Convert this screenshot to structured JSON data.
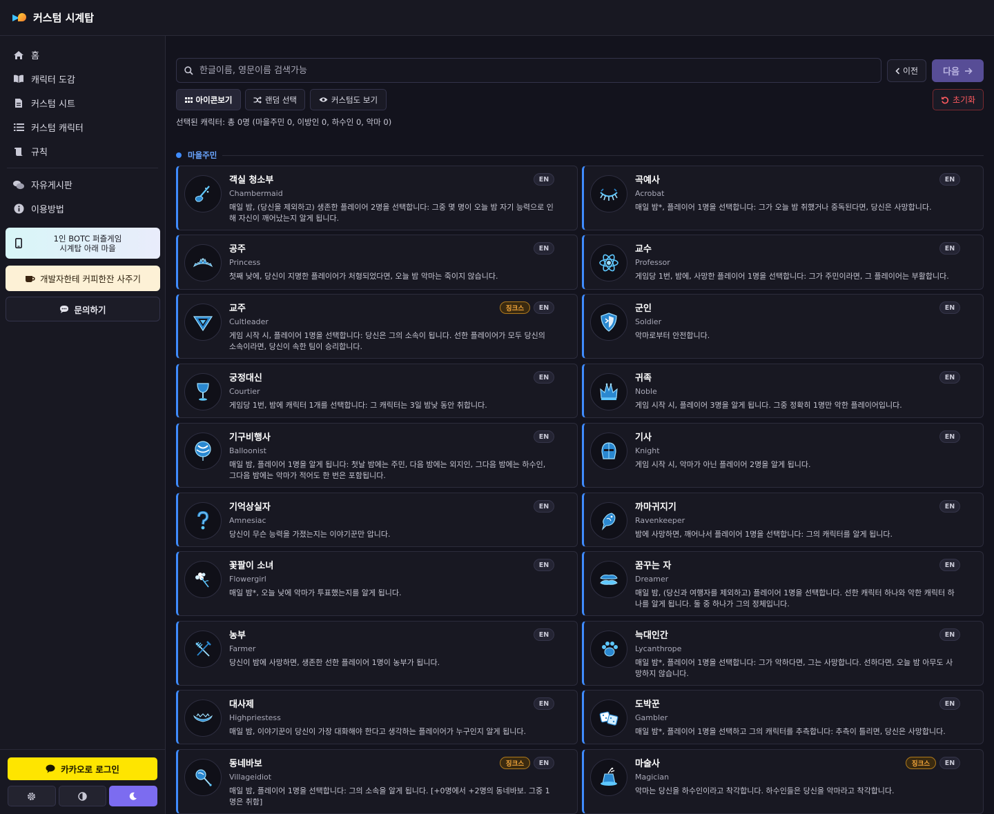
{
  "app": {
    "title": "커스텀 시계탑"
  },
  "sidebar": {
    "items": [
      {
        "label": "홈",
        "icon": "home-icon"
      },
      {
        "label": "캐릭터 도감",
        "icon": "book-icon"
      },
      {
        "label": "커스텀 시트",
        "icon": "document-icon"
      },
      {
        "label": "커스텀 캐릭터",
        "icon": "list-icon"
      },
      {
        "label": "규칙",
        "icon": "scroll-icon"
      },
      {
        "label": "자유게시판",
        "icon": "chat-bubbles-icon"
      },
      {
        "label": "이용방법",
        "icon": "info-icon"
      }
    ],
    "promo_botc": "1인 BOTC 퍼즐게임\n시계탑 아래 마을",
    "promo_botc_line1": "1인 BOTC 퍼즐게임",
    "promo_botc_line2": "시계탑 아래 마을",
    "promo_coffee": "개발자한테 커피한잔 사주기",
    "inquiry": "문의하기",
    "kakao_login": "카카오로 로그인"
  },
  "toolbar": {
    "search_placeholder": "한글이름, 영문이름 검색가능",
    "prev": "이전",
    "next": "다음",
    "icon_view": "아이콘보기",
    "random_select": "랜덤 선택",
    "custom_view": "커스텀도 보기",
    "reset": "초기화"
  },
  "selected_info": "선택된 캐릭터: 총 0명 (마을주민 0, 이방인 0, 하수인 0, 악마 0)",
  "section": {
    "title": "마을주민"
  },
  "badges": {
    "en": "EN",
    "jinx": "징크스"
  },
  "colors": {
    "accent": "#3f8cff",
    "primary": "#7c6cf0",
    "kakao": "#fee500",
    "danger": "#ff5a5f",
    "jinx": "#f2a53a"
  },
  "cards": [
    {
      "name": "객실 청소부",
      "eng": "Chambermaid",
      "desc": "매일 밤, (당신을 제외하고) 생존한 플레이어 2명을 선택합니다: 그중 몇 명이 오늘 밤 자기 능력으로 인해 자신이 깨어났는지 알게 됩니다.",
      "jinx": false,
      "icon": "mop-icon"
    },
    {
      "name": "곡예사",
      "eng": "Acrobat",
      "desc": "매일 밤*, 플레이어 1명을 선택합니다: 그가 오늘 밤 취했거나 중독된다면, 당신은 사망합니다.",
      "jinx": false,
      "icon": "eye-lashes-icon"
    },
    {
      "name": "공주",
      "eng": "Princess",
      "desc": "첫째 낮에, 당신이 지명한 플레이어가 처형되었다면, 오늘 밤 악마는 죽이지 않습니다.",
      "jinx": false,
      "icon": "tiara-icon"
    },
    {
      "name": "교수",
      "eng": "Professor",
      "desc": "게임당 1번, 밤에, 사망한 플레이어 1명을 선택합니다: 그가 주민이라면, 그 플레이어는 부활합니다.",
      "jinx": false,
      "icon": "atom-icon"
    },
    {
      "name": "교주",
      "eng": "Cultleader",
      "desc": "게임 시작 시, 플레이어 1명을 선택합니다: 당신은 그의 소속이 됩니다. 선한 플레이어가 모두 당신의 소속이라면, 당신이 속한 팀이 승리합니다.",
      "jinx": true,
      "icon": "triangle-icon"
    },
    {
      "name": "군인",
      "eng": "Soldier",
      "desc": "악마로부터 안전합니다.",
      "jinx": false,
      "icon": "shield-icon"
    },
    {
      "name": "궁정대신",
      "eng": "Courtier",
      "desc": "게임당 1번, 밤에 캐릭터 1개를 선택합니다: 그 캐릭터는 3일 밤낮 동안 취합니다.",
      "jinx": false,
      "icon": "goblet-icon"
    },
    {
      "name": "귀족",
      "eng": "Noble",
      "desc": "게임 시작 시, 플레이어 3명을 알게 됩니다. 그중 정확히 1명만 악한 플레이어입니다.",
      "jinx": false,
      "icon": "crown-icon"
    },
    {
      "name": "기구비행사",
      "eng": "Balloonist",
      "desc": "매일 밤, 플레이어 1명을 알게 됩니다: 첫날 밤에는 주민, 다음 밤에는 외지인, 그다음 밤에는 하수인, 그다음 밤에는 악마가 적어도 한 번은 포함됩니다.",
      "jinx": false,
      "icon": "balloon-icon"
    },
    {
      "name": "기사",
      "eng": "Knight",
      "desc": "게임 시작 시, 악마가 아닌 플레이어 2명을 알게 됩니다.",
      "jinx": false,
      "icon": "helmet-icon"
    },
    {
      "name": "기억상실자",
      "eng": "Amnesiac",
      "desc": "당신이 무슨 능력을 가졌는지는 이야기꾼만 압니다.",
      "jinx": false,
      "icon": "question-icon"
    },
    {
      "name": "까마귀지기",
      "eng": "Ravenkeeper",
      "desc": "밤에 사망하면, 깨어나서 플레이어 1명을 선택합니다: 그의 캐릭터를 알게 됩니다.",
      "jinx": false,
      "icon": "raven-icon"
    },
    {
      "name": "꽃팔이 소녀",
      "eng": "Flowergirl",
      "desc": "매일 밤*, 오늘 낮에 악마가 투표했는지를 알게 됩니다.",
      "jinx": false,
      "icon": "flower-icon"
    },
    {
      "name": "꿈꾸는 자",
      "eng": "Dreamer",
      "desc": "매일 밤, (당신과 여행자를 제외하고) 플레이어 1명을 선택합니다. 선한 캐릭터 하나와 악한 캐릭터 하나를 알게 됩니다. 둘 중 하나가 그의 정체입니다.",
      "jinx": false,
      "icon": "cloud-icon"
    },
    {
      "name": "농부",
      "eng": "Farmer",
      "desc": "당신이 밤에 사망하면, 생존한 선한 플레이어 1명이 농부가 됩니다.",
      "jinx": false,
      "icon": "pitchfork-icon"
    },
    {
      "name": "늑대인간",
      "eng": "Lycanthrope",
      "desc": "매일 밤*, 플레이어 1명을 선택합니다: 그가 악하다면, 그는 사망합니다. 선하다면, 오늘 밤 아무도 사망하지 않습니다.",
      "jinx": false,
      "icon": "paw-icon"
    },
    {
      "name": "대사제",
      "eng": "Highpriestess",
      "desc": "매일 밤, 이야기꾼이 당신이 가장 대화해야 한다고 생각하는 플레이어가 누구인지 알게 됩니다.",
      "jinx": false,
      "icon": "headdress-icon"
    },
    {
      "name": "도박꾼",
      "eng": "Gambler",
      "desc": "매일 밤*, 플레이어 1명을 선택하고 그의 캐릭터를 추측합니다: 추측이 틀리면, 당신은 사망합니다.",
      "jinx": false,
      "icon": "dice-icon"
    },
    {
      "name": "동네바보",
      "eng": "Villageidiot",
      "desc": "매일 밤, 플레이어 1명을 선택합니다: 그의 소속을 알게 됩니다. [+0명에서 +2명의 동네바보. 그중 1명은 취함]",
      "jinx": true,
      "icon": "rattle-icon"
    },
    {
      "name": "마술사",
      "eng": "Magician",
      "desc": "악마는 당신을 하수인이라고 착각합니다. 하수인들은 당신을 악마라고 착각합니다.",
      "jinx": true,
      "icon": "magic-hat-icon"
    }
  ]
}
